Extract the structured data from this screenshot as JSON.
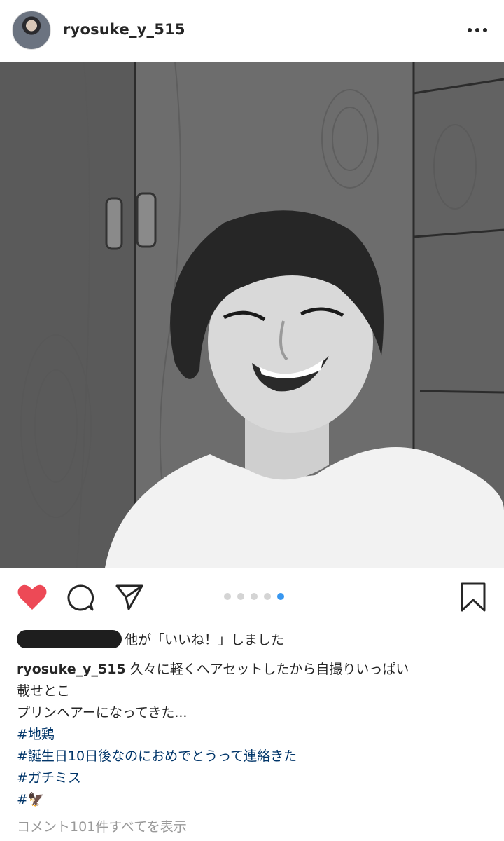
{
  "header": {
    "username": "ryosuke_y_515",
    "more_icon": "more-horizontal-icon"
  },
  "post": {
    "photo_description_icon": "photo",
    "carousel": {
      "total": 5,
      "active_index": 4
    }
  },
  "actions": {
    "like_icon": "heart-filled-icon",
    "comment_icon": "comment-icon",
    "share_icon": "send-icon",
    "save_icon": "bookmark-icon",
    "like_color": "#ed4956"
  },
  "likes": {
    "suffix": "他が「いいね！」しました"
  },
  "caption": {
    "username": "ryosuke_y_515",
    "line1": "久々に軽くヘアセットしたから自撮りいっぱい",
    "line2": "載せとこ",
    "line3": "プリンヘアーになってきた...",
    "hashtags": [
      "#地鶏",
      "#誕生日10日後なのにおめでとうって連絡きた",
      "#ガチミス",
      "#🦅"
    ]
  },
  "comments": {
    "view_all": "コメント101件すべてを表示"
  },
  "colors": {
    "accent": "#3897f0",
    "hashtag": "#003569",
    "muted": "#999999"
  }
}
